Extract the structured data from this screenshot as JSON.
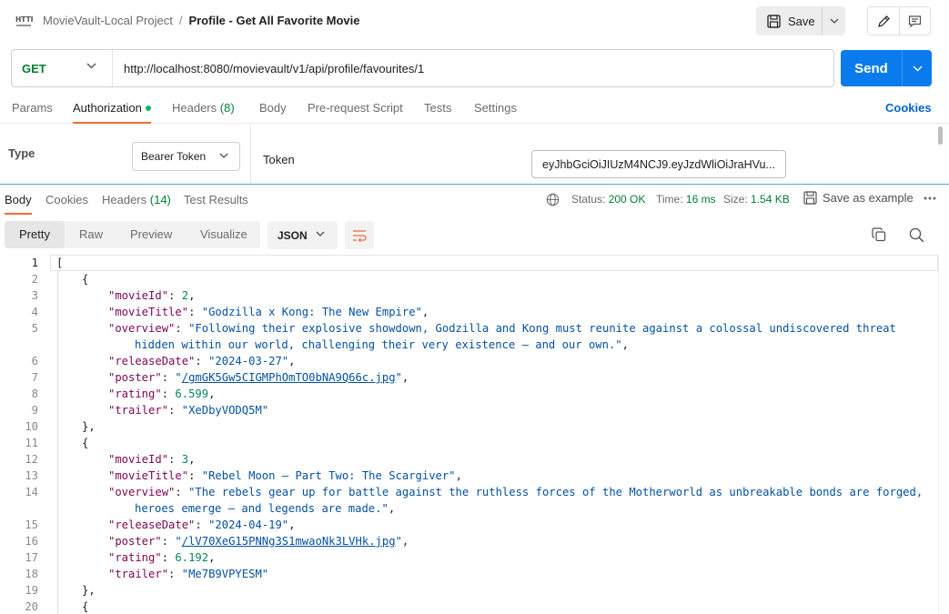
{
  "header": {
    "icon": "http-icon",
    "collection": "MovieVault-Local Project",
    "separator": "/",
    "request_name": "Profile - Get All Favorite Movie",
    "save_label": "Save"
  },
  "request": {
    "method": "GET",
    "url": "http://localhost:8080/movievault/v1/api/profile/favourites/1",
    "send_label": "Send"
  },
  "req_tabs": {
    "params": "Params",
    "authorization": "Authorization",
    "headers": "Headers",
    "headers_count": "(8)",
    "body": "Body",
    "prerequest": "Pre-request Script",
    "tests": "Tests",
    "settings": "Settings",
    "cookies": "Cookies"
  },
  "auth": {
    "type_label": "Type",
    "type_value": "Bearer Token",
    "token_label": "Token",
    "token_value": "eyJhbGciOiJIUzM4NCJ9.eyJzdWliOiJraHVu..."
  },
  "resp_tabs": {
    "body": "Body",
    "cookies": "Cookies",
    "headers": "Headers",
    "headers_count": "(14)",
    "test_results": "Test Results",
    "status_label": "Status:",
    "status_value": "200 OK",
    "time_label": "Time:",
    "time_value": "16 ms",
    "size_label": "Size:",
    "size_value": "1.54 KB",
    "save_example": "Save as example"
  },
  "format_bar": {
    "pretty": "Pretty",
    "raw": "Raw",
    "preview": "Preview",
    "visualize": "Visualize",
    "format": "JSON"
  },
  "code": {
    "line_numbers": [
      "1",
      "2",
      "3",
      "4",
      "5",
      "",
      "6",
      "7",
      "8",
      "9",
      "10",
      "11",
      "12",
      "13",
      "14",
      "",
      "15",
      "16",
      "17",
      "18",
      "19",
      "20"
    ],
    "movies": [
      {
        "movieId": "2",
        "movieTitle": "\"Godzilla x Kong: The New Empire\"",
        "overview_1": "\"Following their explosive showdown, Godzilla and Kong must reunite against a colossal undiscovered threat",
        "overview_2": "hidden within our world, challenging their very existence – and our own.\"",
        "releaseDate": "\"2024-03-27\"",
        "poster": "/gmGK5Gw5CIGMPhOmTO0bNA9Q66c.jpg",
        "rating": "6.599",
        "trailer": "\"XeDbyVODQ5M\""
      },
      {
        "movieId": "3",
        "movieTitle": "\"Rebel Moon – Part Two: The Scargiver\"",
        "overview_1": "\"The rebels gear up for battle against the ruthless forces of the Motherworld as unbreakable bonds are forged,",
        "overview_2": "heroes emerge — and legends are made.\"",
        "releaseDate": "\"2024-04-19\"",
        "poster": "/lV70XeG15PNNg3S1mwaoNk3LVHk.jpg",
        "rating": "6.192",
        "trailer": "\"Me7B9VPYESM\""
      }
    ],
    "keys": {
      "movieId": "\"movieId\"",
      "movieTitle": "\"movieTitle\"",
      "overview": "\"overview\"",
      "releaseDate": "\"releaseDate\"",
      "poster": "\"poster\"",
      "rating": "\"rating\"",
      "trailer": "\"trailer\""
    },
    "open_bracket": "[",
    "open_brace": "{",
    "close_brace": "},"
  },
  "colors": {
    "accent_tab": "#f26b3a",
    "send": "#097bed",
    "method_get": "#007f31",
    "status_ok": "#007f31"
  }
}
